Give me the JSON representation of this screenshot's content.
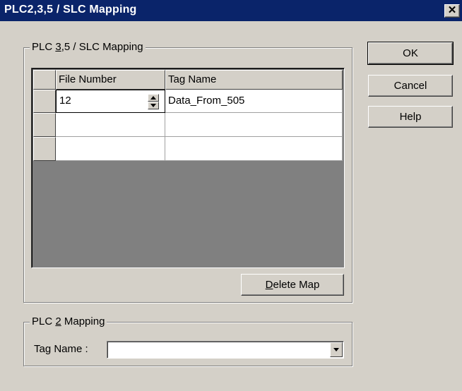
{
  "window": {
    "title": "PLC2,3,5 / SLC Mapping",
    "close_glyph": "✕"
  },
  "plc35_group": {
    "label_prefix": "PLC ",
    "label_accel": "3",
    "label_suffix": ",5 / SLC Mapping"
  },
  "table": {
    "columns": [
      "File Number",
      "Tag Name"
    ],
    "rows": [
      {
        "file_number": "12",
        "tag_name": "Data_From_505"
      },
      {
        "file_number": "",
        "tag_name": ""
      },
      {
        "file_number": "",
        "tag_name": ""
      }
    ]
  },
  "delete_button": {
    "accel": "D",
    "rest": "elete Map"
  },
  "plc2_group": {
    "label_prefix": "PLC ",
    "label_accel": "2",
    "label_suffix": " Mapping",
    "tag_label": "Tag Name :",
    "tag_value": ""
  },
  "buttons": {
    "ok": "OK",
    "cancel": "Cancel",
    "help": "Help"
  },
  "icons": {
    "close": "close-icon",
    "spin_up": "spin-up-arrow-icon",
    "spin_down": "spin-down-arrow-icon",
    "dropdown": "chevron-down-icon"
  }
}
